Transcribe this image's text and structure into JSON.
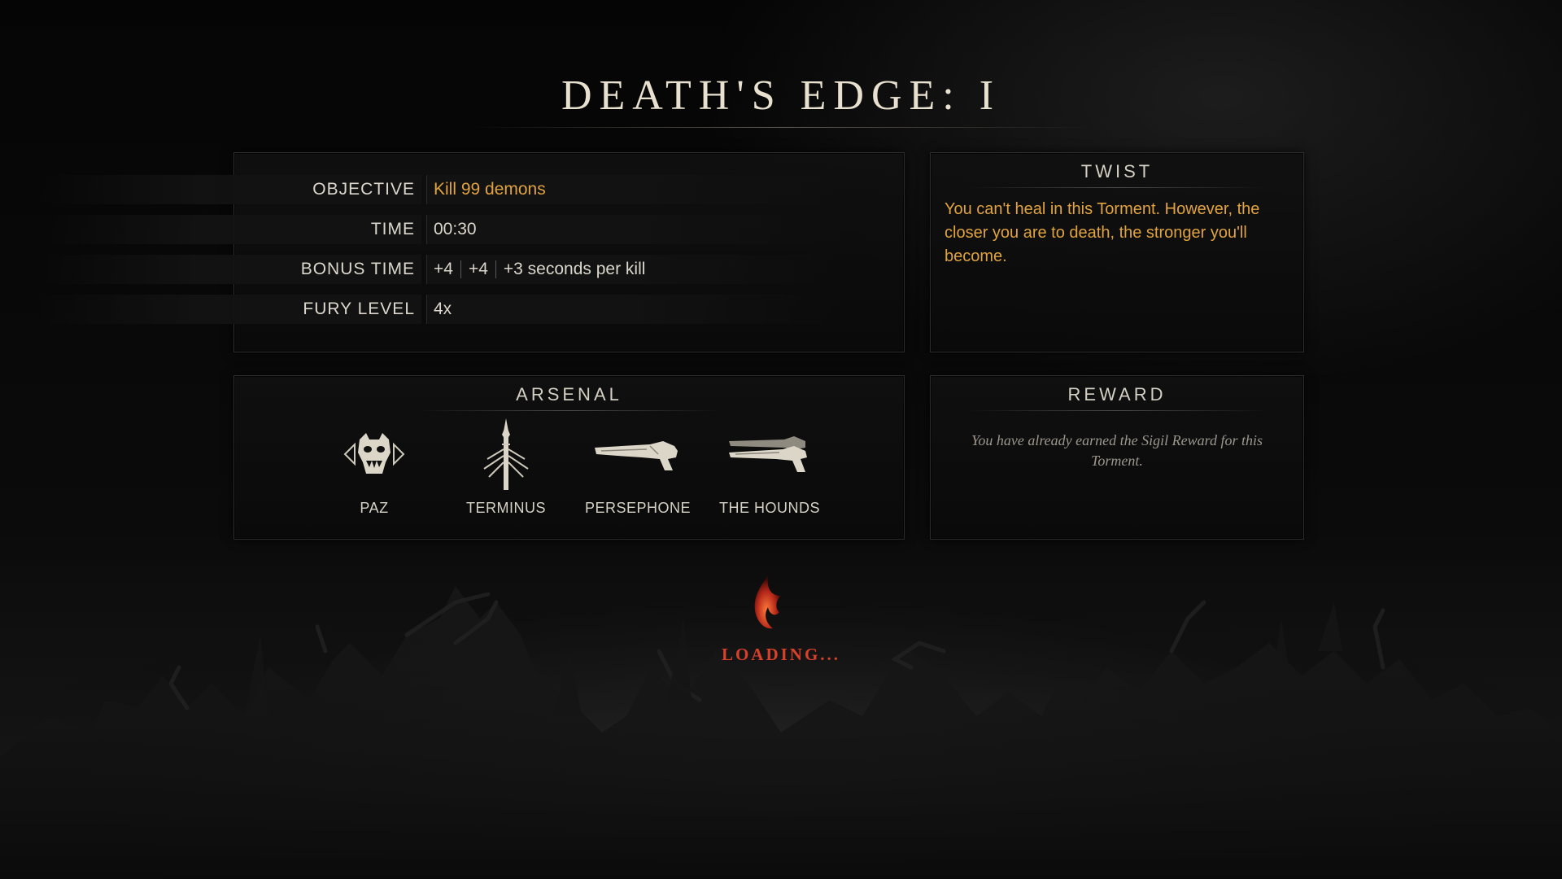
{
  "title": "DEATH'S EDGE: I",
  "info": {
    "rows": [
      {
        "label": "OBJECTIVE",
        "value": "Kill 99 demons"
      },
      {
        "label": "TIME",
        "value": "00:30"
      },
      {
        "label": "BONUS TIME",
        "parts": [
          "+4",
          "+4",
          "+3 seconds per kill"
        ]
      },
      {
        "label": "FURY LEVEL",
        "value": "4x"
      }
    ]
  },
  "twist": {
    "heading": "TWIST",
    "text": "You can't heal in this Torment. However, the closer you are to death, the stronger you'll become."
  },
  "arsenal": {
    "heading": "ARSENAL",
    "weapons": [
      {
        "name": "PAZ",
        "icon": "demon-skull-icon"
      },
      {
        "name": "TERMINUS",
        "icon": "trident-blade-icon"
      },
      {
        "name": "PERSEPHONE",
        "icon": "shotgun-icon"
      },
      {
        "name": "THE HOUNDS",
        "icon": "twin-pistols-icon"
      }
    ]
  },
  "reward": {
    "heading": "REWARD",
    "text": "You have already earned the Sigil Reward for this Torment."
  },
  "loading": {
    "text": "LOADING...",
    "icon": "flame-icon"
  },
  "colors": {
    "accent_gold": "#e0a33f",
    "loading_red": "#d8402a"
  }
}
